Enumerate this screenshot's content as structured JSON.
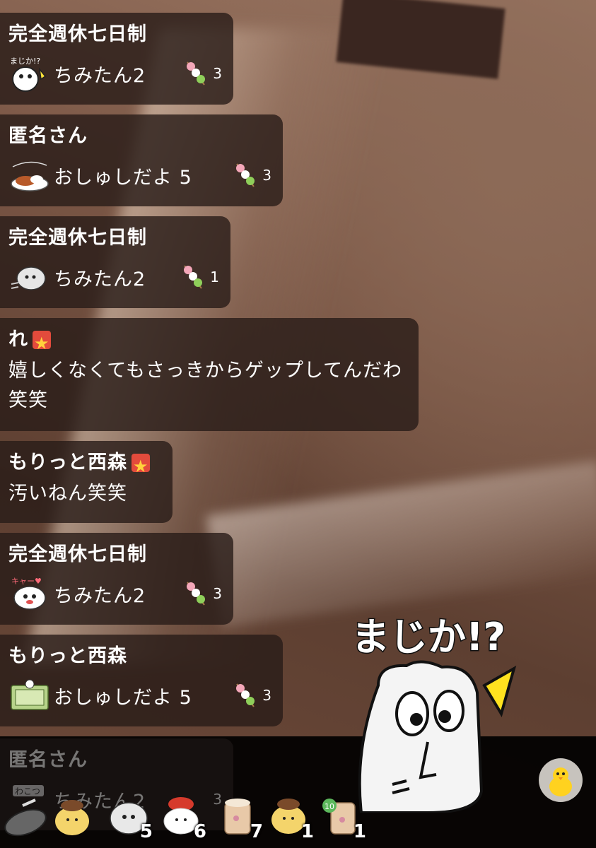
{
  "comments": [
    {
      "name": "完全週休七日制",
      "gift": "ちみたん2",
      "sticker_text": "まじか!?",
      "count": "3",
      "badge": false
    },
    {
      "name": "匿名さん",
      "gift": "おしゅしだよ 5",
      "sticker_text": "カレー",
      "count": "3",
      "badge": false
    },
    {
      "name": "完全週休七日制",
      "gift": "ちみたん2",
      "sticker_text": "",
      "count": "1",
      "badge": false
    },
    {
      "name": "れ",
      "text": "嬉しくなくてもさっきからゲップしてんだわ笑笑",
      "badge": true
    },
    {
      "name": "もりっと西森",
      "text": "汚いねん笑笑",
      "badge": true
    },
    {
      "name": "完全週休七日制",
      "gift": "ちみたん2",
      "sticker_text": "キャー",
      "count": "3",
      "badge": false
    },
    {
      "name": "もりっと西森",
      "gift": "おしゅしだよ 5",
      "sticker_text": "",
      "count": "3",
      "badge": false
    },
    {
      "name": "匿名さん",
      "gift": "ちみたん2",
      "sticker_text": "わこつ",
      "count": "3",
      "badge": false
    }
  ],
  "big_sticker": {
    "text": "まじか!?"
  },
  "gift_tray": [
    {
      "name": "wakotsu-sticker",
      "count": ""
    },
    {
      "name": "pompompurin-sticker",
      "count": ""
    },
    {
      "name": "chimitan-sticker",
      "count": "5"
    },
    {
      "name": "sushi-sticker",
      "count": "6"
    },
    {
      "name": "cup-sticker",
      "count": "7"
    },
    {
      "name": "purin-sticker",
      "count": "1"
    },
    {
      "name": "ten-cup-sticker",
      "count": "1"
    }
  ],
  "colors": {
    "badge_red": "#e34b3c",
    "badge_star": "#ffd23c",
    "bubble": "rgba(40,28,24,0.80)"
  }
}
